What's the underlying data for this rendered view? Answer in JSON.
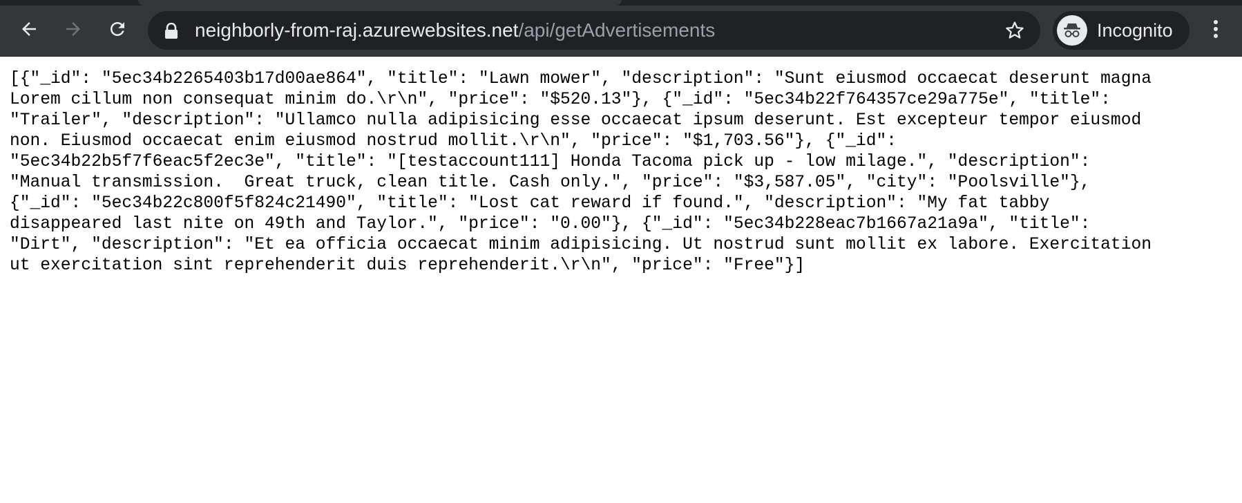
{
  "browser": {
    "url": {
      "host": "neighborly-from-raj.azurewebsites.net",
      "path": "/api/getAdvertisements"
    },
    "profile_label": "Incognito",
    "icons": {
      "back": "arrow-left-icon",
      "forward": "arrow-right-icon",
      "reload": "reload-icon",
      "lock": "lock-icon",
      "bookmark": "star-icon",
      "incognito": "incognito-icon",
      "menu": "kebab-menu-icon"
    },
    "colors": {
      "toolbar": "#35363a",
      "omnibox": "#202124",
      "text": "#e8eaed",
      "url_path": "#9aa0a6"
    }
  },
  "response": {
    "lines": [
      "[{\"_id\": \"5ec34b2265403b17d00ae864\", \"title\": \"Lawn mower\", \"description\": \"Sunt eiusmod occaecat deserunt magna",
      "Lorem cillum non consequat minim do.\\r\\n\", \"price\": \"$520.13\"}, {\"_id\": \"5ec34b22f764357ce29a775e\", \"title\":",
      "\"Trailer\", \"description\": \"Ullamco nulla adipisicing esse occaecat ipsum deserunt. Est excepteur tempor eiusmod",
      "non. Eiusmod occaecat enim eiusmod nostrud mollit.\\r\\n\", \"price\": \"$1,703.56\"}, {\"_id\":",
      "\"5ec34b22b5f7f6eac5f2ec3e\", \"title\": \"[testaccount111] Honda Tacoma pick up - low milage.\", \"description\":",
      "\"Manual transmission.  Great truck, clean title. Cash only.\", \"price\": \"$3,587.05\", \"city\": \"Poolsville\"},",
      "{\"_id\": \"5ec34b22c800f5f824c21490\", \"title\": \"Lost cat reward if found.\", \"description\": \"My fat tabby",
      "disappeared last nite on 49th and Taylor.\", \"price\": \"0.00\"}, {\"_id\": \"5ec34b228eac7b1667a21a9a\", \"title\":",
      "\"Dirt\", \"description\": \"Et ea officia occaecat minim adipisicing. Ut nostrud sunt mollit ex labore. Exercitation",
      "ut exercitation sint reprehenderit duis reprehenderit.\\r\\n\", \"price\": \"Free\"}]"
    ]
  }
}
